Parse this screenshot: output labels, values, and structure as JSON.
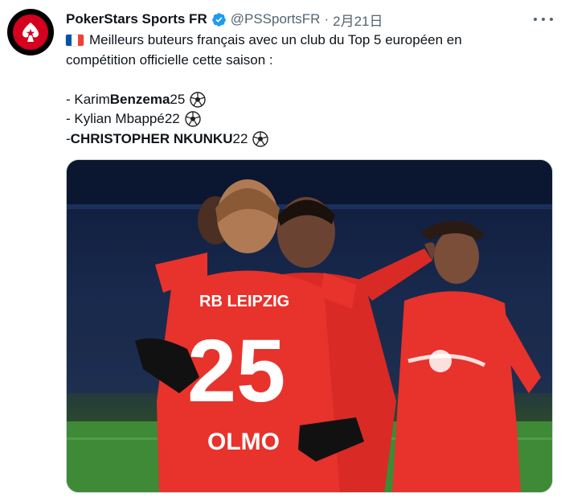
{
  "tweet": {
    "display_name": "PokerStars Sports FR",
    "handle": "@PSSportsFR",
    "separator": "·",
    "date": "2月21日",
    "verified_icon": "verified-badge-icon",
    "more_icon": "more-options-icon",
    "text": {
      "line1": "Meilleurs buteurs français avec un club du Top 5 européen en",
      "line2": "compétition officielle cette saison :",
      "scorers": [
        {
          "prefix": "- Karim ",
          "name_bold": "Benzema",
          "goals": " 25"
        },
        {
          "prefix": "- Kylian Mbappé",
          "name_bold": "",
          "goals": " 22"
        },
        {
          "prefix": "- ",
          "name_bold": "CHRISTOPHER NKUNKU",
          "goals": " 22"
        }
      ]
    },
    "media": {
      "shirt_text": "RB LEIPZIG",
      "number": "25",
      "player_name": "OLMO"
    }
  },
  "colors": {
    "brand_red": "#d4001e",
    "verified_blue": "#1d9bf0",
    "jersey_red": "#e8322c",
    "text_secondary": "#536471"
  }
}
